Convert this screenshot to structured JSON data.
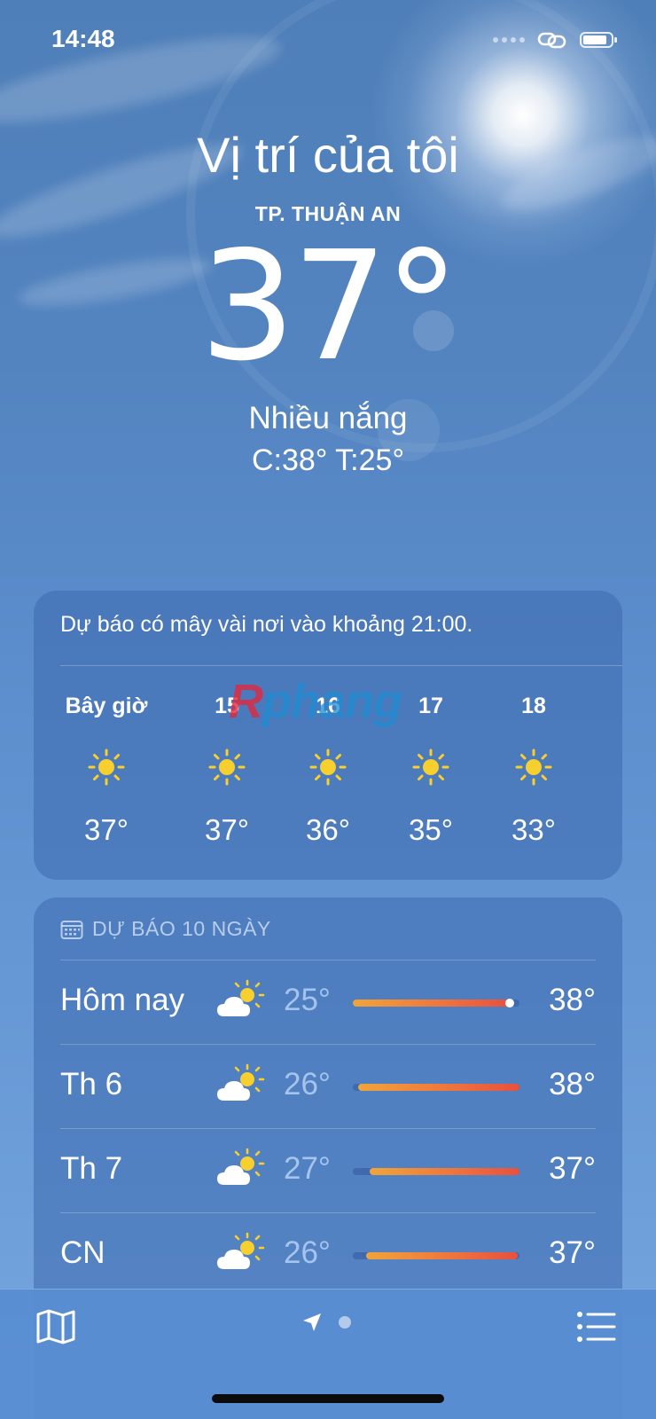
{
  "status_bar": {
    "time": "14:48"
  },
  "header": {
    "title": "Vị trí của tôi",
    "location": "TP. THUẬN AN",
    "temperature": "37°",
    "condition": "Nhiều nắng",
    "hi_lo": "C:38°  T:25°"
  },
  "hourly": {
    "summary": "Dự báo có mây vài nơi vào khoảng 21:00.",
    "hours": [
      {
        "label": "Bây giờ",
        "icon": "sun-icon",
        "temp": "37°"
      },
      {
        "label": "15",
        "icon": "sun-icon",
        "temp": "37°"
      },
      {
        "label": "16",
        "icon": "sun-icon",
        "temp": "36°"
      },
      {
        "label": "17",
        "icon": "sun-icon",
        "temp": "35°"
      },
      {
        "label": "18",
        "icon": "sun-icon",
        "temp": "33°"
      }
    ]
  },
  "watermark": {
    "text_first": "R",
    "text_rest": "phang"
  },
  "daily": {
    "header": "DỰ BÁO 10 NGÀY",
    "days": [
      {
        "name": "Hôm nay",
        "icon": "partly-cloudy-icon",
        "low": "25°",
        "high": "38°",
        "range_start": 0.0,
        "range_end": 0.94,
        "current_marker": 0.94
      },
      {
        "name": "Th 6",
        "icon": "partly-cloudy-icon",
        "low": "26°",
        "high": "38°",
        "range_start": 0.03,
        "range_end": 1.0
      },
      {
        "name": "Th 7",
        "icon": "partly-cloudy-icon",
        "low": "27°",
        "high": "37°",
        "range_start": 0.1,
        "range_end": 1.0
      },
      {
        "name": "CN",
        "icon": "partly-cloudy-icon",
        "low": "26°",
        "high": "37°",
        "range_start": 0.08,
        "range_end": 0.99
      }
    ]
  },
  "toolbar": {
    "left_icon": "map-icon",
    "center_icon": "location-arrow-icon",
    "right_icon": "list-icon"
  },
  "colors": {
    "sun": "#f7cf2e",
    "temp_bar_start": "#f0a53a",
    "temp_bar_end": "#e8503e",
    "card_bg": "#3c69af"
  }
}
